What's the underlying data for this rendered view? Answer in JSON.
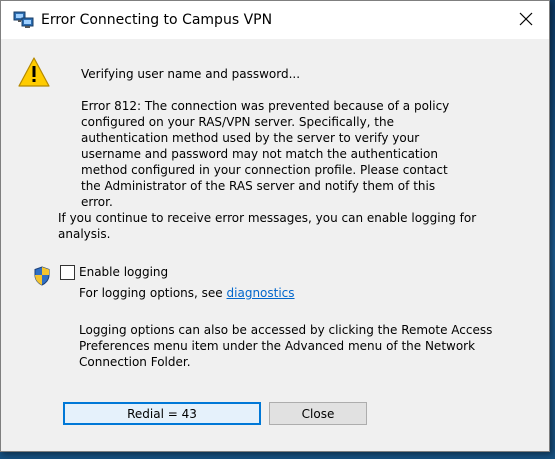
{
  "window": {
    "title": "Error Connecting to Campus VPN",
    "close_glyph": "✕"
  },
  "message": {
    "verifying": "Verifying user name and password...",
    "error": "Error 812: The connection was prevented because of a policy configured on your RAS/VPN server. Specifically, the authentication method used by the server to verify your username and password may not match the authentication method configured in your connection profile. Please contact the Administrator of the RAS server and notify them of this error.",
    "continue": "If you continue to receive error messages, you can enable logging for analysis."
  },
  "logging": {
    "checkbox_label": "Enable logging",
    "checked": false,
    "options_prefix": "For logging options, see ",
    "diagnostics_link": "diagnostics",
    "access_note": "Logging options can also be accessed by clicking the Remote Access Preferences menu item under the Advanced menu of the Network Connection Folder."
  },
  "buttons": {
    "redial_label": "Redial = 43",
    "close_label": "Close"
  },
  "icons": {
    "title": "vpn-network-icon",
    "warning": "warning-icon",
    "shield": "uac-shield-icon",
    "close": "close-icon"
  },
  "colors": {
    "warning_yellow": "#ffcc00",
    "link_blue": "#0066cc",
    "default_button_border": "#0078d7"
  }
}
